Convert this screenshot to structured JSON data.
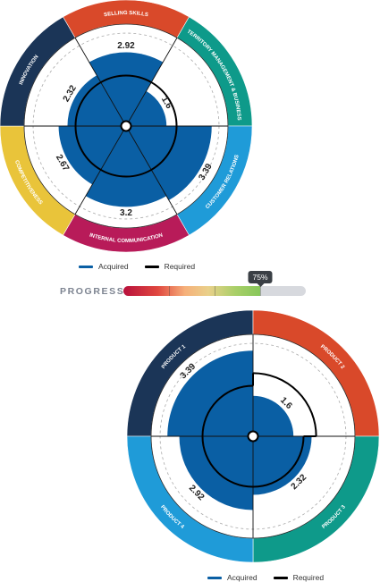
{
  "chart_data": [
    {
      "type": "radial-bar",
      "max_value": 4,
      "categories": [
        "SELLING SKILLS",
        "TERRITORY MANAGEMENT & BUSINESS",
        "CUSTOMER RELATIONS",
        "INTERNAL COMMUNICATION",
        "COMPETITIVENESS",
        "INNOVATION"
      ],
      "category_colors": [
        "#d9492a",
        "#0e9a8a",
        "#1f9bd8",
        "#b81b59",
        "#e9c43a",
        "#1b3557"
      ],
      "series": [
        {
          "name": "Acquired",
          "color": "#0a5fa4",
          "values": [
            2.92,
            1.6,
            3.39,
            3.2,
            2.67,
            2.32
          ]
        },
        {
          "name": "Required",
          "color": "#000000",
          "values": [
            2.0,
            2.0,
            2.0,
            2.0,
            2.0,
            2.0
          ]
        }
      ],
      "data_labels": [
        "2.92",
        "1.6",
        "3.39",
        "3.2",
        "2.67",
        "2.32"
      ]
    },
    {
      "type": "radial-bar",
      "max_value": 4,
      "categories": [
        "PRODUCT 1",
        "PRODUCT 2",
        "PRODUCT 3",
        "PRODUCT 4"
      ],
      "category_colors": [
        "#1b3557",
        "#d9492a",
        "#0e9a8a",
        "#1f9bd8"
      ],
      "series": [
        {
          "name": "Acquired",
          "color": "#0a5fa4",
          "values": [
            3.39,
            1.6,
            2.32,
            2.92
          ]
        },
        {
          "name": "Required",
          "color": "#000000",
          "values": [
            2.0,
            2.5,
            2.0,
            2.0
          ]
        }
      ],
      "data_labels": [
        "3.39",
        "1.6",
        "2.32",
        "2.92"
      ]
    }
  ],
  "legend": {
    "acquired": "Acquired",
    "required": "Required"
  },
  "progress": {
    "label": "PROGRESS",
    "value": 75,
    "badge": "75%"
  }
}
